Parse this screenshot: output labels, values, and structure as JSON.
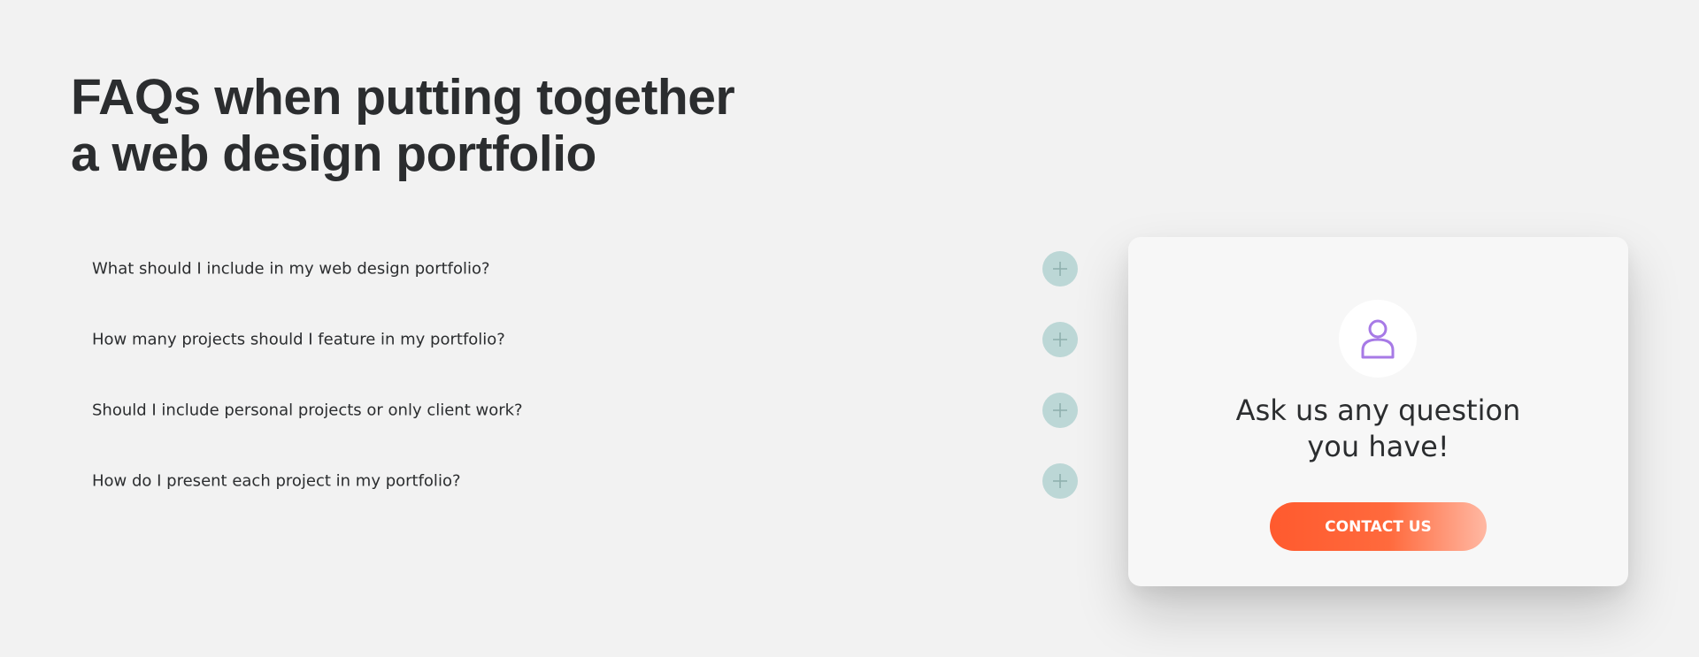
{
  "faq_section": {
    "title_line1": "FAQs when putting together",
    "title_line2": "a web design portfolio",
    "items": [
      {
        "question": "What should I include in my web design portfolio?"
      },
      {
        "question": "How many projects should I feature in my portfolio?"
      },
      {
        "question": "Should I include personal projects or only client work?"
      },
      {
        "question": "How do I present each project in my portfolio?"
      }
    ],
    "toggle_icon": "plus-icon",
    "toggle_color": "#bcd7d6"
  },
  "contact_card": {
    "icon": "user-icon",
    "icon_color": "#a77ae6",
    "title_line1": "Ask us any question",
    "title_line2": "you have!",
    "button_label": "CONTACT US",
    "button_color": "#ff5a2e"
  }
}
